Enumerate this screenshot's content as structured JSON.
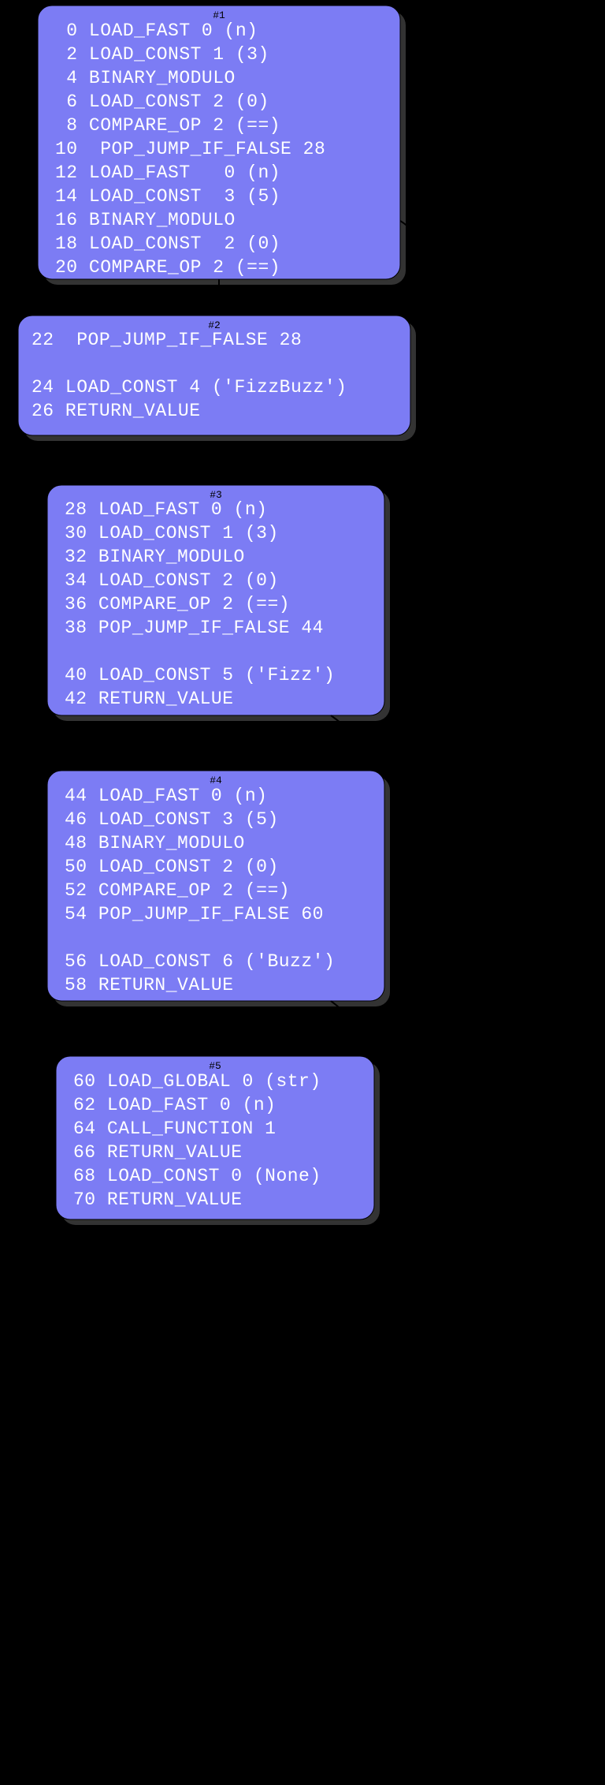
{
  "nodes": [
    {
      "id": 1,
      "label": "#1",
      "lines": [
        " 0 LOAD_FAST 0 (n)",
        " 2 LOAD_CONST 1 (3)",
        " 4 BINARY_MODULO",
        " 6 LOAD_CONST 2 (0)",
        " 8 COMPARE_OP 2 (==)",
        "10  POP_JUMP_IF_FALSE 28",
        "12 LOAD_FAST   0 (n)",
        "14 LOAD_CONST  3 (5)",
        "16 BINARY_MODULO",
        "18 LOAD_CONST  2 (0)",
        "20 COMPARE_OP 2 (==)"
      ]
    },
    {
      "id": 2,
      "label": "#2",
      "lines": [
        "22  POP_JUMP_IF_FALSE 28",
        "",
        "24 LOAD_CONST 4 ('FizzBuzz')",
        "26 RETURN_VALUE"
      ]
    },
    {
      "id": 3,
      "label": "#3",
      "lines": [
        "28 LOAD_FAST 0 (n)",
        "30 LOAD_CONST 1 (3)",
        "32 BINARY_MODULO",
        "34 LOAD_CONST 2 (0)",
        "36 COMPARE_OP 2 (==)",
        "38 POP_JUMP_IF_FALSE 44",
        "",
        "40 LOAD_CONST 5 ('Fizz')",
        "42 RETURN_VALUE"
      ]
    },
    {
      "id": 4,
      "label": "#4",
      "lines": [
        "44 LOAD_FAST 0 (n)",
        "46 LOAD_CONST 3 (5)",
        "48 BINARY_MODULO",
        "50 LOAD_CONST 2 (0)",
        "52 COMPARE_OP 2 (==)",
        "54 POP_JUMP_IF_FALSE 60",
        "",
        "56 LOAD_CONST 6 ('Buzz')",
        "58 RETURN_VALUE"
      ]
    },
    {
      "id": 5,
      "label": "#5",
      "lines": [
        "60 LOAD_GLOBAL 0 (str)",
        "62 LOAD_FAST 0 (n)",
        "64 CALL_FUNCTION 1",
        "66 RETURN_VALUE",
        "68 LOAD_CONST 0 (None)",
        "70 RETURN_VALUE"
      ]
    }
  ],
  "edges": [
    {
      "from": 1,
      "to": 2,
      "type": "straight"
    },
    {
      "from": 1,
      "to": 3,
      "type": "curve-right"
    },
    {
      "from": 3,
      "to": 4,
      "type": "curve-right-short"
    },
    {
      "from": 4,
      "to": 5,
      "type": "curve-right-short"
    }
  ]
}
